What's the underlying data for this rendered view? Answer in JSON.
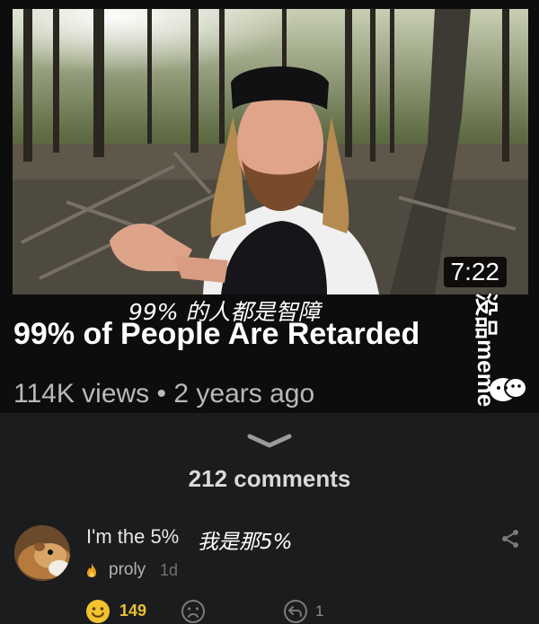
{
  "video": {
    "duration": "7:22",
    "subtitle_cn": "99% 的人都是智障",
    "title": "99% of People Are Retarded",
    "views": "114K views",
    "separator": "•",
    "age": "2 years ago"
  },
  "watermark": {
    "text": "没品meme"
  },
  "comments": {
    "count_label": "212 comments"
  },
  "comment": {
    "text": "I'm the 5%",
    "translation_cn": "我是那5%",
    "username": "proly",
    "age": "1d",
    "likes": "149",
    "replies": "1"
  },
  "colors": {
    "background": "#1b1c1e",
    "video_panel": "#0d0d0d",
    "likes_accent": "#e8c234",
    "fire_icon": "#f0a020"
  },
  "icons": [
    "chevron-down-icon",
    "share-icon",
    "fire-icon",
    "smile-icon",
    "frown-icon",
    "reply-icon"
  ]
}
